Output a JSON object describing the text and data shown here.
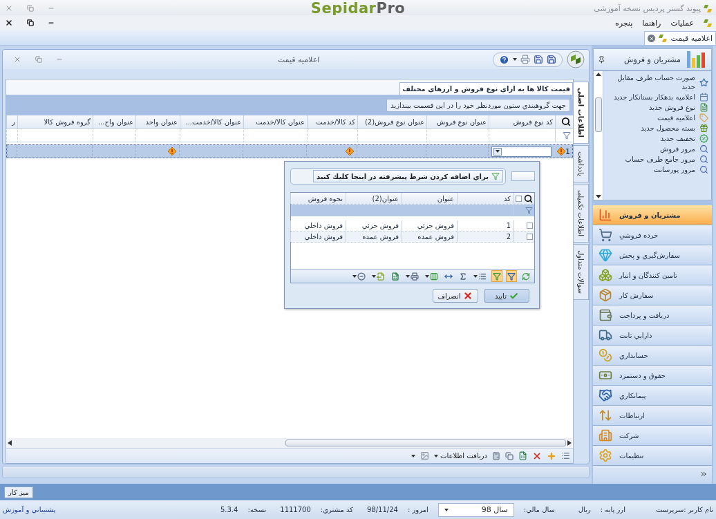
{
  "app": {
    "title": "پیوند گستر پردیس نسخه آموزشی",
    "logo_primary": "Sepidar",
    "logo_secondary": "Pro"
  },
  "menu": [
    {
      "label": "عملیات"
    },
    {
      "label": "راهنما"
    },
    {
      "label": "پنجره"
    }
  ],
  "document_tabs": [
    {
      "label": "اعلامیه قیمت",
      "selected": true
    }
  ],
  "document": {
    "title": "اعلامیه قیمت",
    "side_tabs": [
      {
        "label": "اطلاعات اصلی",
        "selected": true
      },
      {
        "label": "یادداشت",
        "selected": false
      },
      {
        "label": "اطلاعات تکمیلی",
        "selected": false
      },
      {
        "label": "سوالات متداول",
        "selected": false
      }
    ],
    "grid": {
      "caption": "قیمت کالا ها به ازاي نوع فروش و ارزهاي مختلف",
      "group_hint": "جهت گروهبندي ستون موردنظر خود را در اين قسمت بيندازيد",
      "columns": [
        "کد نوع فروش",
        "عنوان نوع فروش",
        "عنوان نوع فروش(2)",
        "کد کالا/خدمت",
        "عنوان کالا/خدمت",
        "عنوان کالا/خدمت...",
        "عنوان واحد",
        "عنوان واح...",
        "گروه فروش کالا",
        "ر"
      ],
      "rows": [
        {
          "number": "1",
          "selected": true,
          "error": true,
          "cells": [
            {
              "kind": "dropdown",
              "error": false
            },
            {
              "kind": "text",
              "error": false
            },
            {
              "kind": "text",
              "error": false
            },
            {
              "kind": "text",
              "error": true
            },
            {
              "kind": "text",
              "error": false
            },
            {
              "kind": "text",
              "error": false
            },
            {
              "kind": "text",
              "error": true
            },
            {
              "kind": "text",
              "error": false
            },
            {
              "kind": "text",
              "error": false
            },
            {
              "kind": "text",
              "error": false
            }
          ]
        }
      ]
    },
    "toolbar": {
      "fetch_label": "دریافت اطلاعات"
    }
  },
  "lookup": {
    "advanced_filter": "براي اضافه كردن شرط پيشرفته در اينجا كليك كنيد",
    "all_checked": false,
    "columns": [
      "کد",
      "عنوان",
      "عنوان(2)",
      "نحوه فروش"
    ],
    "rows": [
      {
        "checked": false,
        "cells": [
          "1",
          "فروش جزئي",
          "فروش جزئي",
          "فروش داخلي"
        ]
      },
      {
        "checked": false,
        "cells": [
          "2",
          "فروش عمده",
          "فروش عمده",
          "فروش داخلي"
        ]
      }
    ],
    "tools": [
      {
        "kind": "refresh",
        "on": false,
        "menu": false
      },
      {
        "kind": "filter",
        "on": true,
        "menu": false
      },
      {
        "kind": "filter-row",
        "on": true,
        "menu": false
      },
      {
        "kind": "group",
        "on": false,
        "menu": true
      },
      {
        "kind": "sum",
        "on": false,
        "menu": false
      },
      {
        "kind": "fit",
        "on": false,
        "menu": false
      },
      {
        "kind": "columns",
        "on": false,
        "menu": true
      },
      {
        "kind": "print",
        "on": false,
        "menu": true
      },
      {
        "kind": "excel",
        "on": false,
        "menu": false
      },
      {
        "kind": "export",
        "on": false,
        "menu": true
      },
      {
        "kind": "circle",
        "on": false,
        "menu": true
      }
    ],
    "buttons": [
      {
        "kind": "ok",
        "label": "تاييد"
      },
      {
        "kind": "cancel",
        "label": "انصراف"
      }
    ]
  },
  "sidebar": {
    "title": "مشتریان و فروش",
    "items": [
      "صورت حساب طرف مقابل جدید",
      "اعلامیه بدهکار بستانکار جدید",
      "نوع فروش جدید",
      "اعلامیه قیمت",
      "بسته محصول جدید",
      "تخفیف جدید",
      "مرور فروش",
      "مرور جامع طرف حساب",
      "مرور پورسانت"
    ],
    "sections": [
      {
        "label": "مشتریان و فروش",
        "selected": true
      },
      {
        "label": "خرده فروشي",
        "selected": false
      },
      {
        "label": "سفارش‌گيري و پخش",
        "selected": false
      },
      {
        "label": "تامين كنندگان و انبار",
        "selected": false
      },
      {
        "label": "سفارش كار",
        "selected": false
      },
      {
        "label": "دريافت و پرداخت",
        "selected": false
      },
      {
        "label": "دارايي ثابت",
        "selected": false
      },
      {
        "label": "حسابداري",
        "selected": false
      },
      {
        "label": "حقوق و دستمزد",
        "selected": false
      },
      {
        "label": "پيمانكاري",
        "selected": false
      },
      {
        "label": "ارتباطات",
        "selected": false
      },
      {
        "label": "شركت",
        "selected": false
      },
      {
        "label": "تنظيمات",
        "selected": false
      }
    ]
  },
  "desk_button": "میز کار",
  "status_bar": {
    "user": "نام كاربر :سرپرست",
    "base_currency_label": "ارز پايه :",
    "base_currency": "ريال",
    "fiscal_year_label": "سال مالي:",
    "fiscal_year": "سال 98",
    "today_label": "امروز :",
    "today": "98/11/24",
    "customer_code_label": "كد مشتري:",
    "customer_code": "1111700",
    "version_label": "نسخه:",
    "version": "5.3.4",
    "support_link": "پشتيباني و آموزش"
  }
}
